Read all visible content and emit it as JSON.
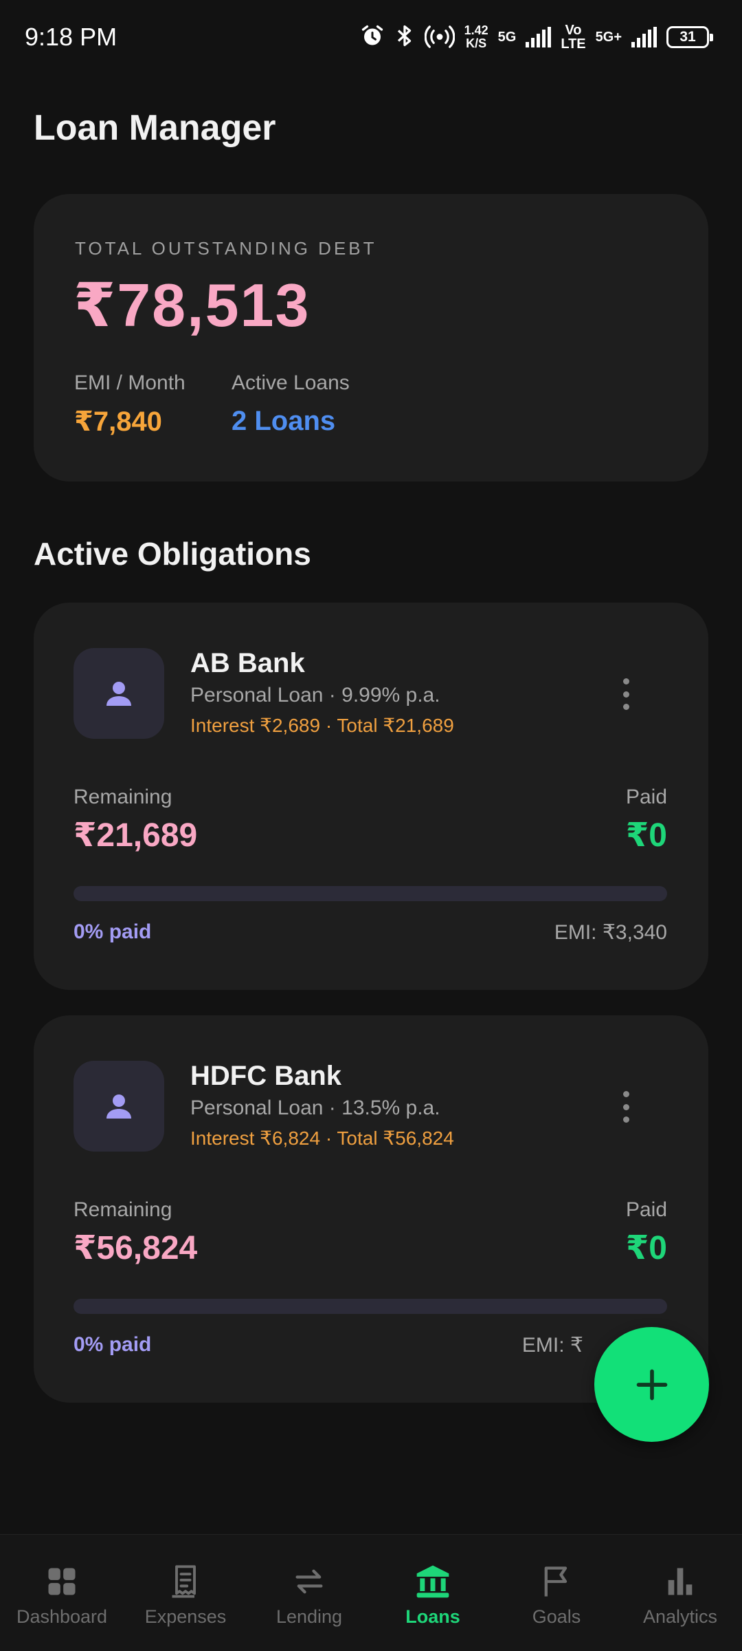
{
  "status_bar": {
    "time": "9:18 PM",
    "net_speed_value": "1.42",
    "net_speed_unit": "K/S",
    "sim1_label": "5G",
    "volte_top": "Vo",
    "volte_bottom": "LTE",
    "sim2_label": "5G+",
    "battery": "31",
    "icons": [
      "alarm-icon",
      "bluetooth-icon",
      "hotspot-icon",
      "signal-icon",
      "signal-icon",
      "battery-icon"
    ]
  },
  "header": {
    "title": "Loan Manager"
  },
  "summary": {
    "label": "TOTAL OUTSTANDING DEBT",
    "total": "₹78,513",
    "emi_label": "EMI / Month",
    "emi_value": "₹7,840",
    "active_label": "Active Loans",
    "active_value": "2 Loans"
  },
  "section": {
    "title": "Active Obligations"
  },
  "loans": [
    {
      "name": "AB Bank",
      "type": "Personal Loan · 9.99% p.a.",
      "interest": "Interest ₹2,689 · Total ₹21,689",
      "remaining_label": "Remaining",
      "remaining": "₹21,689",
      "paid_label": "Paid",
      "paid": "₹0",
      "progress_pct": 0,
      "paid_pct_text": "0% paid",
      "emi": "EMI: ₹3,340"
    },
    {
      "name": "HDFC Bank",
      "type": "Personal Loan · 13.5% p.a.",
      "interest": "Interest ₹6,824 · Total ₹56,824",
      "remaining_label": "Remaining",
      "remaining": "₹56,824",
      "paid_label": "Paid",
      "paid": "₹0",
      "progress_pct": 0,
      "paid_pct_text": "0% paid",
      "emi": "EMI: ₹"
    }
  ],
  "fab": {
    "icon": "plus-icon"
  },
  "nav": {
    "items": [
      {
        "label": "Dashboard",
        "icon": "dashboard-icon"
      },
      {
        "label": "Expenses",
        "icon": "receipt-icon"
      },
      {
        "label": "Lending",
        "icon": "swap-icon"
      },
      {
        "label": "Loans",
        "icon": "bank-icon"
      },
      {
        "label": "Goals",
        "icon": "flag-icon"
      },
      {
        "label": "Analytics",
        "icon": "bar-chart-icon"
      }
    ],
    "active": "Loans"
  },
  "colors": {
    "background": "#121212",
    "card": "#1e1e1e",
    "debt_pink": "#f9a8c4",
    "emi_orange": "#f7a53a",
    "loans_blue": "#4f8ef0",
    "paid_green": "#1ed679",
    "progress_purple": "#a39cf4",
    "fab_green": "#12e078"
  }
}
